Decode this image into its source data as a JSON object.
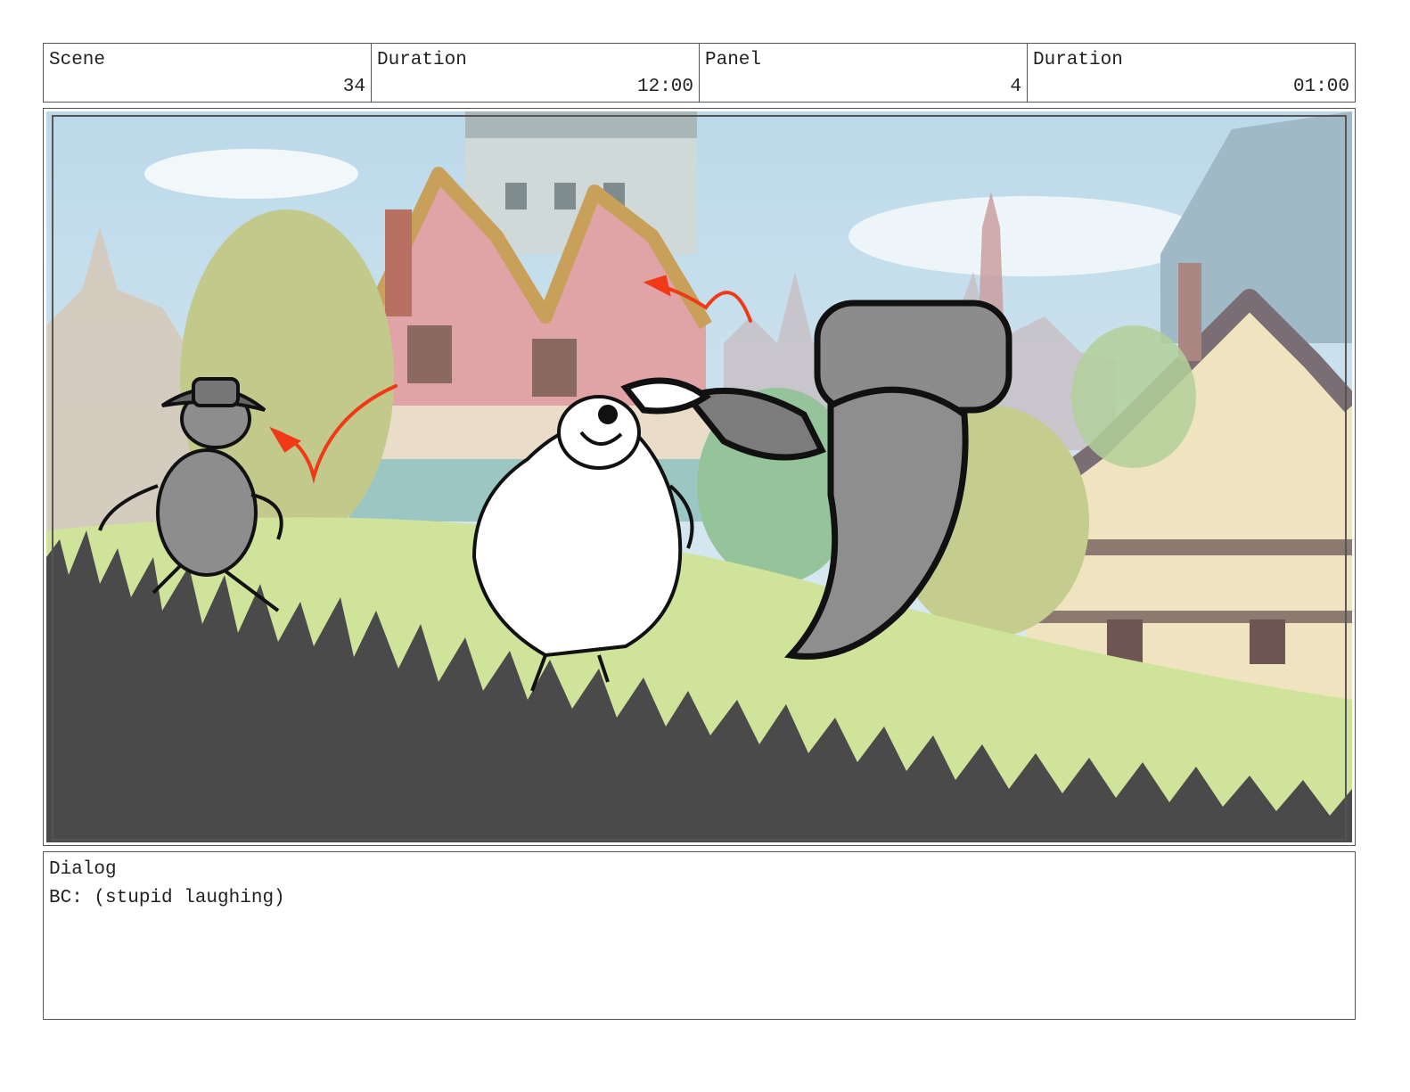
{
  "header": {
    "scene_label": "Scene",
    "scene_value": "34",
    "scene_duration_label": "Duration",
    "scene_duration_value": "12:00",
    "panel_label": "Panel",
    "panel_value": "4",
    "panel_duration_label": "Duration",
    "panel_duration_value": "01:00"
  },
  "dialog": {
    "label": "Dialog",
    "text": "BC: (stupid laughing)"
  },
  "colors": {
    "sky": "#cfe6f2",
    "grass": "#cfe49a",
    "foreground": "#4a4a4a",
    "arrow": "#f03a17"
  }
}
